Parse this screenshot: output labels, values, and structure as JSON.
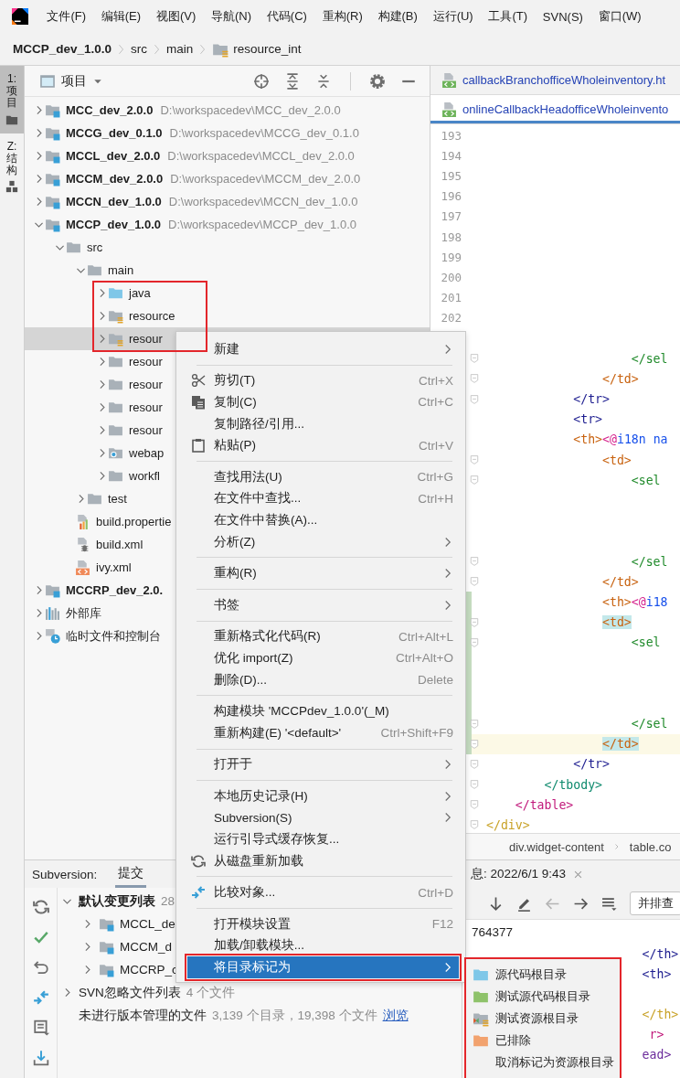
{
  "menu_bar": {
    "items": [
      "文件(F)",
      "编辑(E)",
      "视图(V)",
      "导航(N)",
      "代码(C)",
      "重构(R)",
      "构建(B)",
      "运行(U)",
      "工具(T)",
      "SVN(S)",
      "窗口(W)"
    ]
  },
  "breadcrumb": [
    {
      "label": "MCCP_dev_1.0.0",
      "kind": "module"
    },
    {
      "label": "src",
      "kind": "plain"
    },
    {
      "label": "main",
      "kind": "plain"
    },
    {
      "label": "resource_int",
      "kind": "resource-folder"
    }
  ],
  "tool_strip": [
    {
      "label": "1: 项目",
      "kind": "project",
      "selected": true
    },
    {
      "label": "Z: 结构",
      "kind": "structure",
      "selected": false
    }
  ],
  "project_panel": {
    "title": "项目",
    "tree": [
      {
        "name": "MCC_dev_2.0.0",
        "path": "D:\\workspacedev\\MCC_dev_2.0.0",
        "kind": "module",
        "expanded": false,
        "selected": false
      },
      {
        "name": "MCCG_dev_0.1.0",
        "path": "D:\\workspacedev\\MCCG_dev_0.1.0",
        "kind": "module",
        "expanded": false,
        "selected": false
      },
      {
        "name": "MCCL_dev_2.0.0",
        "path": "D:\\workspacedev\\MCCL_dev_2.0.0",
        "kind": "module",
        "expanded": false,
        "selected": false
      },
      {
        "name": "MCCM_dev_2.0.0",
        "path": "D:\\workspacedev\\MCCM_dev_2.0.0",
        "kind": "module",
        "expanded": false,
        "selected": false
      },
      {
        "name": "MCCN_dev_1.0.0",
        "path": "D:\\workspacedev\\MCCN_dev_1.0.0",
        "kind": "module",
        "expanded": false,
        "selected": false
      },
      {
        "name": "MCCP_dev_1.0.0",
        "path": "D:\\workspacedev\\MCCP_dev_1.0.0",
        "kind": "module",
        "expanded": true,
        "selected": false,
        "children": [
          {
            "name": "src",
            "kind": "folder",
            "expanded": true,
            "selected": false,
            "children": [
              {
                "name": "main",
                "kind": "folder",
                "expanded": true,
                "selected": false,
                "children": [
                  {
                    "name": "java",
                    "kind": "source-folder",
                    "expanded": false,
                    "selected": false,
                    "boxed": true
                  },
                  {
                    "name": "resource",
                    "kind": "resource-folder",
                    "expanded": false,
                    "selected": false,
                    "boxed": true
                  },
                  {
                    "name": "resour",
                    "kind": "resource-folder",
                    "expanded": false,
                    "selected": true,
                    "boxed": true
                  },
                  {
                    "name": "resour",
                    "kind": "folder",
                    "expanded": false,
                    "selected": false
                  },
                  {
                    "name": "resour",
                    "kind": "folder",
                    "expanded": false,
                    "selected": false
                  },
                  {
                    "name": "resour",
                    "kind": "folder",
                    "expanded": false,
                    "selected": false
                  },
                  {
                    "name": "resour",
                    "kind": "folder",
                    "expanded": false,
                    "selected": false
                  },
                  {
                    "name": "webap",
                    "kind": "web-folder",
                    "expanded": false,
                    "selected": false
                  },
                  {
                    "name": "workfl",
                    "kind": "folder",
                    "expanded": false,
                    "selected": false
                  }
                ]
              },
              {
                "name": "test",
                "kind": "folder",
                "expanded": false,
                "selected": false
              }
            ]
          },
          {
            "name": "build.propertie",
            "kind": "properties-file",
            "selected": false
          },
          {
            "name": "build.xml",
            "kind": "ant-file",
            "selected": false
          },
          {
            "name": "ivy.xml",
            "kind": "xml-file",
            "selected": false
          }
        ]
      },
      {
        "name": "MCCRP_dev_2.0.",
        "kind": "module",
        "expanded": false,
        "selected": false
      },
      {
        "name": "外部库",
        "kind": "library",
        "expanded": false,
        "selected": false
      },
      {
        "name": "临时文件和控制台",
        "kind": "scratch",
        "expanded": false,
        "selected": false
      }
    ]
  },
  "editor": {
    "tabs": [
      {
        "label": "callbackBranchofficeWholeinventory.ht",
        "selected": false
      },
      {
        "label": "onlineCallbackHeadofficeWholeinvento",
        "selected": true
      }
    ],
    "lines": [
      {
        "kind": "blank",
        "number": "193"
      },
      {
        "kind": "blank",
        "number": "194"
      },
      {
        "kind": "blank",
        "number": "195"
      },
      {
        "kind": "blank",
        "number": "196"
      },
      {
        "kind": "blank",
        "number": "197"
      },
      {
        "kind": "blank",
        "number": "198"
      },
      {
        "kind": "blank",
        "number": "199"
      },
      {
        "kind": "blank",
        "number": "200"
      },
      {
        "kind": "blank",
        "number": "201"
      },
      {
        "kind": "blank",
        "number": "202"
      },
      {
        "kind": "blank"
      },
      {
        "kind": "code",
        "fold": true,
        "segments": [
          {
            "text": "                    </sel",
            "color": "#1f8a2a"
          }
        ]
      },
      {
        "kind": "code",
        "fold": true,
        "segments": [
          {
            "text": "                </td>",
            "color": "#c8620f"
          }
        ]
      },
      {
        "kind": "code",
        "fold": true,
        "segments": [
          {
            "text": "            </tr>",
            "color": "#1c1c8f"
          }
        ]
      },
      {
        "kind": "code",
        "segments": [
          {
            "text": "            <tr>",
            "color": "#1c1c8f"
          }
        ]
      },
      {
        "kind": "code",
        "segments": [
          {
            "text": "            <th>",
            "color": "#c8620f"
          },
          {
            "text": "<@",
            "color": "#d41c8a"
          },
          {
            "text": "i18n na",
            "color": "#1750eb"
          }
        ]
      },
      {
        "kind": "code",
        "fold": true,
        "segments": [
          {
            "text": "                <td>",
            "color": "#c8620f"
          }
        ]
      },
      {
        "kind": "code",
        "fold": true,
        "segments": [
          {
            "text": "                    <sel",
            "color": "#1f8a2a"
          }
        ]
      },
      {
        "kind": "blank"
      },
      {
        "kind": "blank"
      },
      {
        "kind": "blank"
      },
      {
        "kind": "code",
        "fold": true,
        "segments": [
          {
            "text": "                    </sel",
            "color": "#1f8a2a"
          }
        ]
      },
      {
        "kind": "code",
        "fold": true,
        "segments": [
          {
            "text": "                </td>",
            "color": "#c8620f"
          }
        ]
      },
      {
        "kind": "code",
        "changed": true,
        "segments": [
          {
            "text": "                <th>",
            "color": "#c8620f"
          },
          {
            "text": "<@",
            "color": "#d41c8a"
          },
          {
            "text": "i18",
            "color": "#1750eb"
          }
        ]
      },
      {
        "kind": "code",
        "changed": true,
        "fold": true,
        "segments": [
          {
            "text": "                <td>",
            "color": "#c8620f",
            "match": true
          }
        ]
      },
      {
        "kind": "code",
        "changed": true,
        "fold": true,
        "segments": [
          {
            "text": "                    <sel",
            "color": "#1f8a2a"
          }
        ]
      },
      {
        "kind": "blank",
        "changed": true
      },
      {
        "kind": "blank",
        "changed": true
      },
      {
        "kind": "blank",
        "changed": true
      },
      {
        "kind": "code",
        "changed": true,
        "fold": true,
        "segments": [
          {
            "text": "                    </sel",
            "color": "#1f8a2a"
          }
        ]
      },
      {
        "kind": "code",
        "changed": true,
        "current": true,
        "fold": true,
        "segments": [
          {
            "text": "                </td>",
            "color": "#c8620f",
            "match": true
          }
        ]
      },
      {
        "kind": "code",
        "fold": true,
        "segments": [
          {
            "text": "            </tr>",
            "color": "#1c1c8f"
          }
        ]
      },
      {
        "kind": "code",
        "fold": true,
        "segments": [
          {
            "text": "        </tbody>",
            "color": "#0e8a6d"
          }
        ]
      },
      {
        "kind": "code",
        "fold": true,
        "segments": [
          {
            "text": "    </table>",
            "color": "#c1177a"
          }
        ]
      },
      {
        "kind": "code",
        "fold": true,
        "segments": [
          {
            "text": "</div>",
            "color": "#c9a227"
          }
        ]
      }
    ],
    "breadcrumb": [
      "div.widget-content",
      "table.co"
    ]
  },
  "bottom_panel": {
    "title": "Subversion:",
    "tabs": [
      {
        "label": "提交",
        "selected": true
      }
    ],
    "changes": [
      {
        "label": "默认变更列表",
        "count": "28",
        "expanded": true,
        "children": [
          {
            "label": "MCCL_de"
          },
          {
            "label": "MCCM_d"
          },
          {
            "label": "MCCRP_c"
          }
        ]
      },
      {
        "label": "SVN忽略文件列表",
        "count": "4 个文件",
        "expanded": false
      },
      {
        "label": "未进行版本管理的文件",
        "count": "3,139 个目录，19,398 个文件",
        "link": "浏览"
      }
    ],
    "details": {
      "title": "息: 2022/6/1 9:43",
      "button": "并排查",
      "revision": "764377",
      "lines": [
        {
          "kind": "code",
          "segments": [
            {
              "text": "                        </th>",
              "color": "#1c1c8f"
            }
          ]
        },
        {
          "kind": "code",
          "segments": [
            {
              "text": "                        <th>",
              "color": "#1c1c8f"
            }
          ]
        },
        {
          "kind": "blank"
        },
        {
          "kind": "code",
          "segments": [
            {
              "text": "                        </th>",
              "color": "#c9a227"
            }
          ]
        },
        {
          "kind": "code",
          "segments": [
            {
              "text": "                         r>",
              "color": "#c1177a"
            }
          ]
        },
        {
          "kind": "code",
          "segments": [
            {
              "text": "                        ead>",
              "color": "#6a2a9a"
            }
          ]
        }
      ]
    }
  },
  "context_menu": {
    "groups": [
      [
        {
          "label": "新建",
          "submenu": true,
          "kind": "plain",
          "selected": false
        }
      ],
      [
        {
          "label": "剪切(T)",
          "shortcut": "Ctrl+X",
          "kind": "cut",
          "selected": false
        },
        {
          "label": "复制(C)",
          "shortcut": "Ctrl+C",
          "kind": "copy",
          "selected": false
        },
        {
          "label": "复制路径/引用...",
          "kind": "plain",
          "selected": false
        },
        {
          "label": "粘贴(P)",
          "shortcut": "Ctrl+V",
          "kind": "paste",
          "selected": false
        }
      ],
      [
        {
          "label": "查找用法(U)",
          "shortcut": "Ctrl+G",
          "kind": "plain",
          "selected": false
        },
        {
          "label": "在文件中查找...",
          "shortcut": "Ctrl+H",
          "kind": "plain",
          "selected": false
        },
        {
          "label": "在文件中替换(A)...",
          "kind": "plain",
          "selected": false
        },
        {
          "label": "分析(Z)",
          "submenu": true,
          "kind": "plain",
          "selected": false
        }
      ],
      [
        {
          "label": "重构(R)",
          "submenu": true,
          "kind": "plain",
          "selected": false
        }
      ],
      [
        {
          "label": "书签",
          "submenu": true,
          "kind": "plain",
          "selected": false
        }
      ],
      [
        {
          "label": "重新格式化代码(R)",
          "shortcut": "Ctrl+Alt+L",
          "kind": "plain",
          "selected": false
        },
        {
          "label": "优化 import(Z)",
          "shortcut": "Ctrl+Alt+O",
          "kind": "plain",
          "selected": false
        },
        {
          "label": "删除(D)...",
          "shortcut": "Delete",
          "kind": "plain",
          "selected": false
        }
      ],
      [
        {
          "label": "构建模块 'MCCPdev_1.0.0'(_M)",
          "kind": "plain",
          "selected": false
        },
        {
          "label": "重新构建(E) '<default>'",
          "shortcut": "Ctrl+Shift+F9",
          "kind": "plain",
          "selected": false
        }
      ],
      [
        {
          "label": "打开于",
          "submenu": true,
          "kind": "plain",
          "selected": false
        }
      ],
      [
        {
          "label": "本地历史记录(H)",
          "submenu": true,
          "kind": "plain",
          "selected": false
        },
        {
          "label": "Subversion(S)",
          "submenu": true,
          "kind": "plain",
          "selected": false
        },
        {
          "label": "运行引导式缓存恢复...",
          "kind": "plain",
          "selected": false
        },
        {
          "label": "从磁盘重新加载",
          "kind": "reload",
          "selected": false
        }
      ],
      [
        {
          "label": "比较对象...",
          "shortcut": "Ctrl+D",
          "kind": "compare",
          "selected": false
        }
      ],
      [
        {
          "label": "打开模块设置",
          "shortcut": "F12",
          "kind": "plain",
          "selected": false
        },
        {
          "label": "加载/卸载模块...",
          "kind": "plain",
          "selected": false
        },
        {
          "label": "将目录标记为",
          "submenu": true,
          "kind": "plain",
          "selected": true,
          "boxed": true
        }
      ]
    ]
  },
  "submenu": {
    "boxed": true,
    "items": [
      {
        "label": "源代码根目录",
        "kind": "folder",
        "color": "#7fc7e8"
      },
      {
        "label": "测试源代码根目录",
        "kind": "folder",
        "color": "#8ec26a"
      },
      {
        "label": "测试资源根目录",
        "kind": "test-resource"
      },
      {
        "label": "已排除",
        "kind": "folder",
        "color": "#f2a26e"
      },
      {
        "label": "取消标记为资源根目录",
        "kind": "plain"
      }
    ]
  }
}
